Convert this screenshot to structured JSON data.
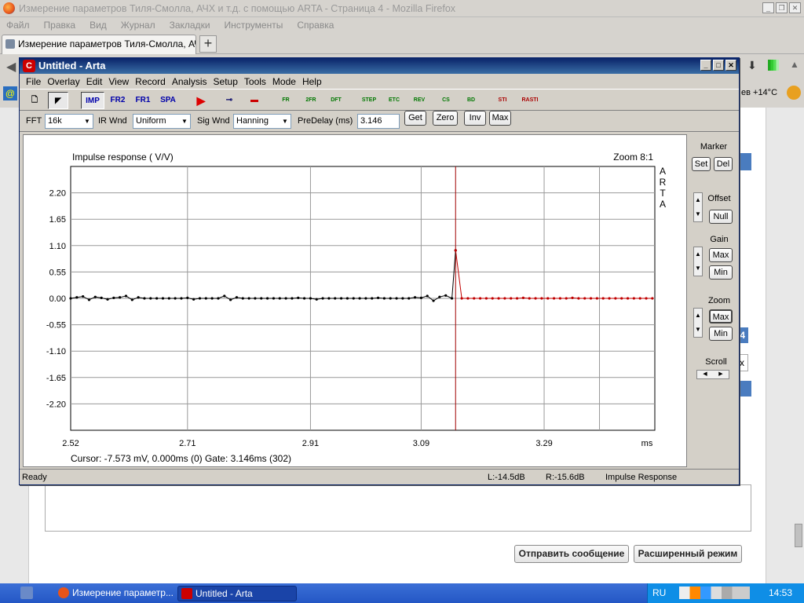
{
  "browser": {
    "window_title": "Измерение параметров Тиля-Смолла, АЧХ и т.д. с помощью ARTA - Страница 4 - Mozilla Firefox",
    "menu": [
      "Файл",
      "Правка",
      "Вид",
      "Журнал",
      "Закладки",
      "Инструменты",
      "Справка"
    ],
    "tab_label": "Измерение параметров Тиля-Смолла, АЧХ...",
    "new_tab": "+",
    "weather": "ев +14°C",
    "side_digit": "4",
    "side_x": "x",
    "send_button": "Отправить сообщение",
    "advanced_button": "Расширенный режим"
  },
  "arta": {
    "title": "Untitled - Arta",
    "menu": [
      "File",
      "Overlay",
      "Edit",
      "View",
      "Record",
      "Analysis",
      "Setup",
      "Tools",
      "Mode",
      "Help"
    ],
    "toolbar_labels": [
      "IMP",
      "FR2",
      "FR1",
      "SPA"
    ],
    "toolbar_icons": [
      "FR",
      "2FR",
      "DFT",
      "STEP",
      "ETC",
      "REV",
      "CS",
      "BD",
      "STI",
      "RASTI"
    ],
    "fft_label": "FFT",
    "fft_value": "16k",
    "ir_wnd_label": "IR Wnd",
    "ir_wnd_value": "Uniform",
    "sig_wnd_label": "Sig Wnd",
    "sig_wnd_value": "Hanning",
    "predelay_label": "PreDelay (ms)",
    "predelay_value": "3.146",
    "btn_get": "Get",
    "btn_zero": "Zero",
    "btn_inv": "Inv",
    "btn_max": "Max",
    "side": {
      "marker": "Marker",
      "set": "Set",
      "del": "Del",
      "offset": "Offset",
      "null": "Null",
      "gain": "Gain",
      "gain_max": "Max",
      "gain_min": "Min",
      "zoom": "Zoom",
      "zoom_max": "Max",
      "zoom_min": "Min",
      "scroll": "Scroll"
    },
    "status": {
      "ready": "Ready",
      "left": "L:-14.5dB",
      "right": "R:-15.6dB",
      "mode": "Impulse Response"
    },
    "cursor_text": "Cursor: -7.573 mV, 0.000ms (0)  Gate: 3.146ms (302)"
  },
  "taskbar": {
    "item1": "Измерение параметр...",
    "item2": "Untitled - Arta",
    "lang": "RU",
    "clock": "14:53"
  },
  "chart_data": {
    "type": "line",
    "title": "Impulse response ( V/V)",
    "zoom_label": "Zoom 8:1",
    "brand_vertical": "ARTA",
    "xlabel": "ms",
    "x_ticks": [
      "2.52",
      "2.71",
      "2.91",
      "3.09",
      "3.29"
    ],
    "y_ticks": [
      "2.20",
      "1.65",
      "1.10",
      "0.55",
      "0.00",
      "-0.55",
      "-1.10",
      "-1.65",
      "-2.20"
    ],
    "xlim": [
      2.52,
      3.47
    ],
    "ylim": [
      -2.75,
      2.75
    ],
    "marker_x": 3.146,
    "gate_x": 3.146,
    "series": [
      {
        "color": "#000000",
        "points": [
          [
            2.52,
            0.0
          ],
          [
            2.53,
            0.02
          ],
          [
            2.54,
            0.04
          ],
          [
            2.55,
            -0.03
          ],
          [
            2.56,
            0.03
          ],
          [
            2.57,
            0.01
          ],
          [
            2.58,
            -0.02
          ],
          [
            2.59,
            0.01
          ],
          [
            2.6,
            0.02
          ],
          [
            2.61,
            0.05
          ],
          [
            2.62,
            -0.03
          ],
          [
            2.63,
            0.02
          ],
          [
            2.64,
            0.0
          ],
          [
            2.65,
            0.0
          ],
          [
            2.66,
            0.0
          ],
          [
            2.67,
            0.0
          ],
          [
            2.68,
            0.0
          ],
          [
            2.69,
            0.0
          ],
          [
            2.7,
            0.0
          ],
          [
            2.71,
            0.01
          ],
          [
            2.72,
            -0.02
          ],
          [
            2.73,
            0.0
          ],
          [
            2.74,
            0.0
          ],
          [
            2.75,
            0.0
          ],
          [
            2.76,
            0.0
          ],
          [
            2.77,
            0.05
          ],
          [
            2.78,
            -0.03
          ],
          [
            2.79,
            0.02
          ],
          [
            2.8,
            0.0
          ],
          [
            2.81,
            0.0
          ],
          [
            2.82,
            0.0
          ],
          [
            2.83,
            0.0
          ],
          [
            2.84,
            0.0
          ],
          [
            2.85,
            0.0
          ],
          [
            2.86,
            0.0
          ],
          [
            2.87,
            0.0
          ],
          [
            2.88,
            0.0
          ],
          [
            2.89,
            0.01
          ],
          [
            2.9,
            0.0
          ],
          [
            2.91,
            0.0
          ],
          [
            2.92,
            -0.02
          ],
          [
            2.93,
            0.0
          ],
          [
            2.94,
            0.0
          ],
          [
            2.95,
            0.0
          ],
          [
            2.96,
            0.0
          ],
          [
            2.97,
            0.0
          ],
          [
            2.98,
            0.0
          ],
          [
            2.99,
            0.0
          ],
          [
            3.0,
            0.0
          ],
          [
            3.01,
            0.0
          ],
          [
            3.02,
            0.01
          ],
          [
            3.03,
            0.0
          ],
          [
            3.04,
            0.0
          ],
          [
            3.05,
            0.0
          ],
          [
            3.06,
            0.0
          ],
          [
            3.07,
            0.0
          ],
          [
            3.08,
            0.02
          ],
          [
            3.09,
            0.01
          ],
          [
            3.1,
            0.05
          ],
          [
            3.11,
            -0.05
          ],
          [
            3.12,
            0.03
          ],
          [
            3.13,
            0.06
          ],
          [
            3.14,
            0.0
          ],
          [
            3.146,
            1.0
          ]
        ]
      },
      {
        "color": "#c00000",
        "points": [
          [
            3.146,
            1.0
          ],
          [
            3.156,
            0.0
          ],
          [
            3.166,
            0.0
          ],
          [
            3.176,
            0.0
          ],
          [
            3.186,
            0.0
          ],
          [
            3.196,
            0.0
          ],
          [
            3.206,
            0.0
          ],
          [
            3.216,
            0.0
          ],
          [
            3.226,
            0.0
          ],
          [
            3.236,
            0.0
          ],
          [
            3.246,
            0.0
          ],
          [
            3.256,
            0.01
          ],
          [
            3.266,
            0.0
          ],
          [
            3.276,
            0.0
          ],
          [
            3.286,
            0.0
          ],
          [
            3.296,
            0.0
          ],
          [
            3.306,
            0.0
          ],
          [
            3.316,
            0.0
          ],
          [
            3.326,
            0.0
          ],
          [
            3.336,
            0.01
          ],
          [
            3.346,
            0.0
          ],
          [
            3.356,
            0.0
          ],
          [
            3.366,
            0.0
          ],
          [
            3.376,
            0.0
          ],
          [
            3.386,
            0.0
          ],
          [
            3.396,
            0.0
          ],
          [
            3.406,
            0.0
          ],
          [
            3.416,
            0.0
          ],
          [
            3.426,
            0.0
          ],
          [
            3.436,
            0.0
          ],
          [
            3.446,
            0.0
          ],
          [
            3.456,
            0.0
          ],
          [
            3.466,
            0.0
          ]
        ]
      }
    ]
  }
}
